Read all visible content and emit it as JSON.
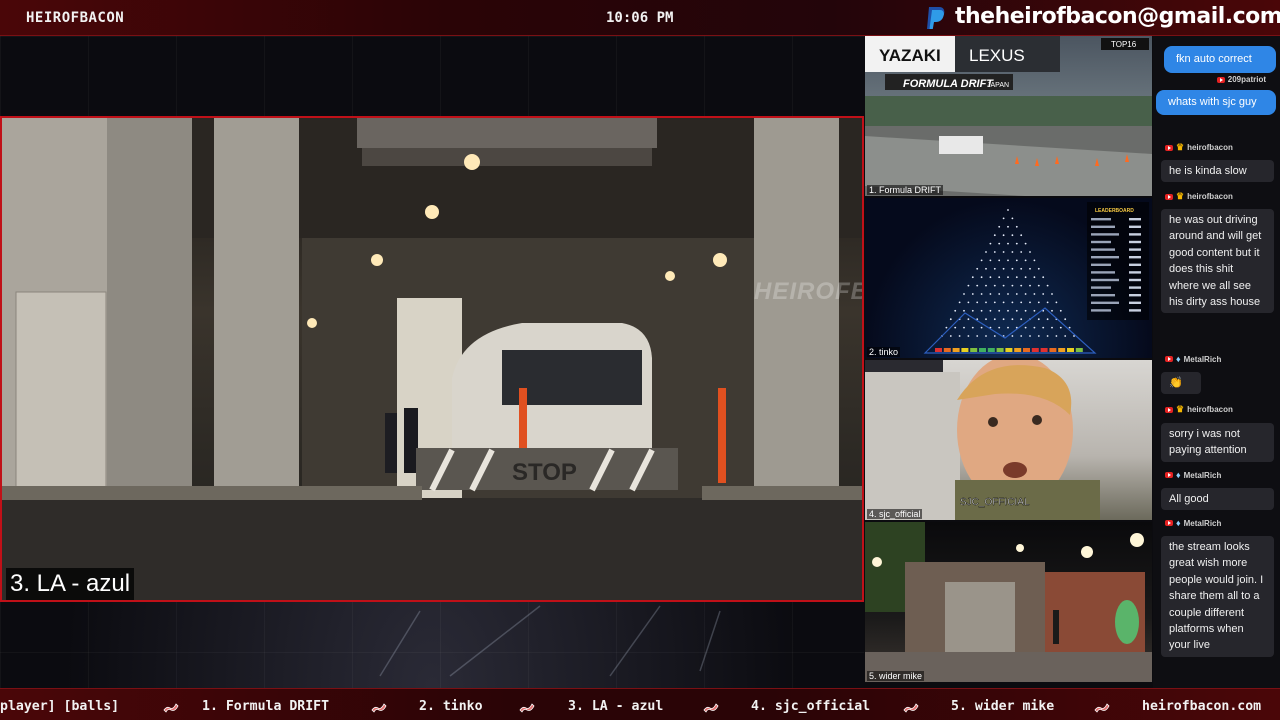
{
  "topbar": {
    "channel": "HEIROFBACON",
    "clock": "10:06 PM",
    "email": "theheirofbacon@gmail.com",
    "paypal_icon": "paypal-icon"
  },
  "main": {
    "label": "3. LA - azul",
    "watermark": "HEIROFBACON",
    "sign_text": "STOP"
  },
  "tiles": [
    {
      "label": "1. Formula DRIFT",
      "sign1": "YAZAKI",
      "sign2": "LEXUS",
      "banner": "FORMULA DRIFT",
      "banner_sub": "JAPAN",
      "top16": "TOP16"
    },
    {
      "label": "2. tinko",
      "leaderboard": "LEADERBOARD"
    },
    {
      "label": "4. sjc_official",
      "overlay": "SJC_OFFICIAL"
    },
    {
      "label": "5. wider mike"
    }
  ],
  "chat": {
    "messages": [
      {
        "side": "right",
        "text": "fkn auto correct",
        "user": "209patriot"
      },
      {
        "side": "right",
        "text": "whats with sjc guy",
        "user": ""
      },
      {
        "side": "left",
        "user": "heirofbacon",
        "badge": "crown",
        "text": "he is kinda slow"
      },
      {
        "side": "left",
        "user": "heirofbacon",
        "badge": "crown",
        "text": "he was out driving around and will get good content but it does this shit where we all see his dirty ass house"
      },
      {
        "side": "left",
        "user": "MetalRich",
        "badge": "diamond",
        "text": "👏"
      },
      {
        "side": "left",
        "user": "heirofbacon",
        "badge": "crown",
        "text": "sorry i was not paying attention"
      },
      {
        "side": "left",
        "user": "MetalRich",
        "badge": "diamond",
        "text": "All good"
      },
      {
        "side": "left",
        "user": "MetalRich",
        "badge": "diamond",
        "text": "the stream looks great wish more people would join. I share them all to a couple different platforms when your live"
      }
    ]
  },
  "ticker": {
    "items": [
      "player] [balls]",
      "1. Formula DRIFT",
      "2. tinko",
      "3. LA - azul",
      "4. sjc_official",
      "5. wider mike",
      "heirofbacon.com"
    ]
  },
  "colors": {
    "accent_red": "#c01018",
    "bar_dark": "#2a0406",
    "chat_blue": "#2f86e6"
  }
}
